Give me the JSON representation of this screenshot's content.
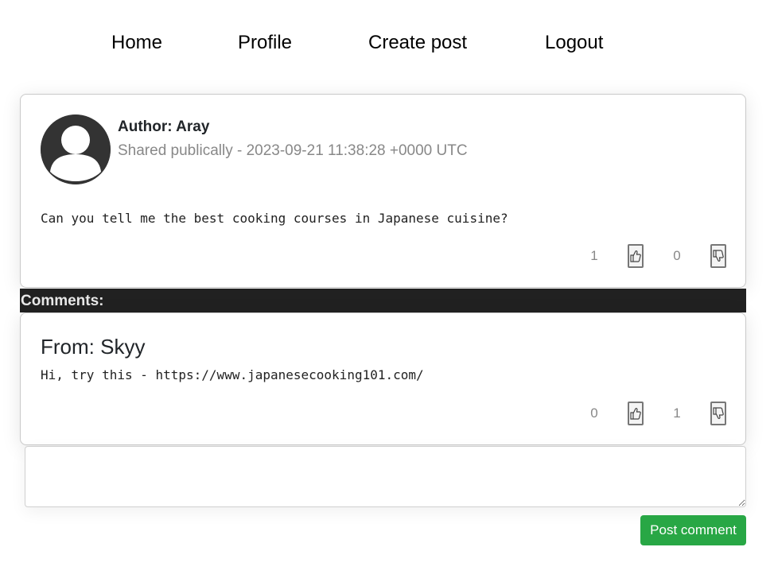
{
  "nav": {
    "items": [
      {
        "label": "Home"
      },
      {
        "label": "Profile"
      },
      {
        "label": "Create post"
      },
      {
        "label": "Logout"
      }
    ]
  },
  "post": {
    "author": "Author: Aray",
    "meta": "Shared publically - 2023-09-21 11:38:28 +0000 UTC",
    "body": "Can you tell me the best cooking courses in Japanese cuisine?",
    "likes": "1",
    "dislikes": "0"
  },
  "comments_header": "Comments:",
  "comments": [
    {
      "from": "From: Skyy",
      "body": "Hi, try this - https://www.japanesecooking101.com/",
      "likes": "0",
      "dislikes": "1"
    }
  ],
  "comment_form": {
    "value": "",
    "placeholder": "",
    "submit_label": "Post comment"
  },
  "icons": {
    "avatar": "user-avatar-icon",
    "like": "thumbs-up-icon",
    "dislike": "thumbs-down-icon"
  },
  "colors": {
    "accent": "#28a745",
    "comments_bar": "#212121",
    "avatar": "#333333"
  }
}
